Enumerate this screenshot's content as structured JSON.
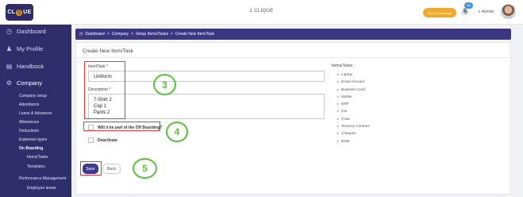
{
  "header": {
    "logo_pre": "CL",
    "logo_q": "Q",
    "logo_post": "UE",
    "app_title": "1 CLIQUE",
    "onboard_button": "Start Onboarding",
    "notification_count": "99",
    "user_name": "Ayman"
  },
  "sidebar": {
    "items": [
      {
        "label": "Dashboard",
        "icon": "dashboard-icon"
      },
      {
        "label": "My Profile",
        "icon": "user-icon"
      },
      {
        "label": "Handbook",
        "icon": "book-icon"
      },
      {
        "label": "Company",
        "icon": "gear-icon"
      }
    ],
    "company_sub": [
      "Company setup",
      "Attendance",
      "Loans & Advances",
      "Allowances",
      "Deductions",
      "Expenses types",
      "On Boarding",
      "Items/Tasks",
      "Templates",
      "Performance Management",
      "Employee levels"
    ]
  },
  "breadcrumb": {
    "items": [
      "Dashboard",
      "Company",
      "Setup Items/Tasks",
      "Create New Item/Task"
    ]
  },
  "form": {
    "title": "Create New Item/Task",
    "item_label": "Item/Task *",
    "item_value": "Uniform",
    "description_label": "Description *",
    "description_lines": [
      "T-Shirt 2",
      "Cap 1",
      "Pants 2"
    ],
    "offboarding_label": "Will it be part of the Off Boarding?",
    "deactivate_label": "Deactivate",
    "save_label": "Save",
    "back_label": "Back"
  },
  "tasks": {
    "title": "Items/Tasks",
    "items": [
      "Laptop",
      "Email Account",
      "Business Card",
      "Mobile",
      "ERP",
      "Car",
      "Chair",
      "Tenancy Contract",
      "Cheques",
      "Desk"
    ]
  },
  "annotations": {
    "step_3": "3",
    "step_4": "4",
    "step_5": "5",
    "highlight_color": "#e0393e",
    "circle_color": "#58c33a"
  }
}
